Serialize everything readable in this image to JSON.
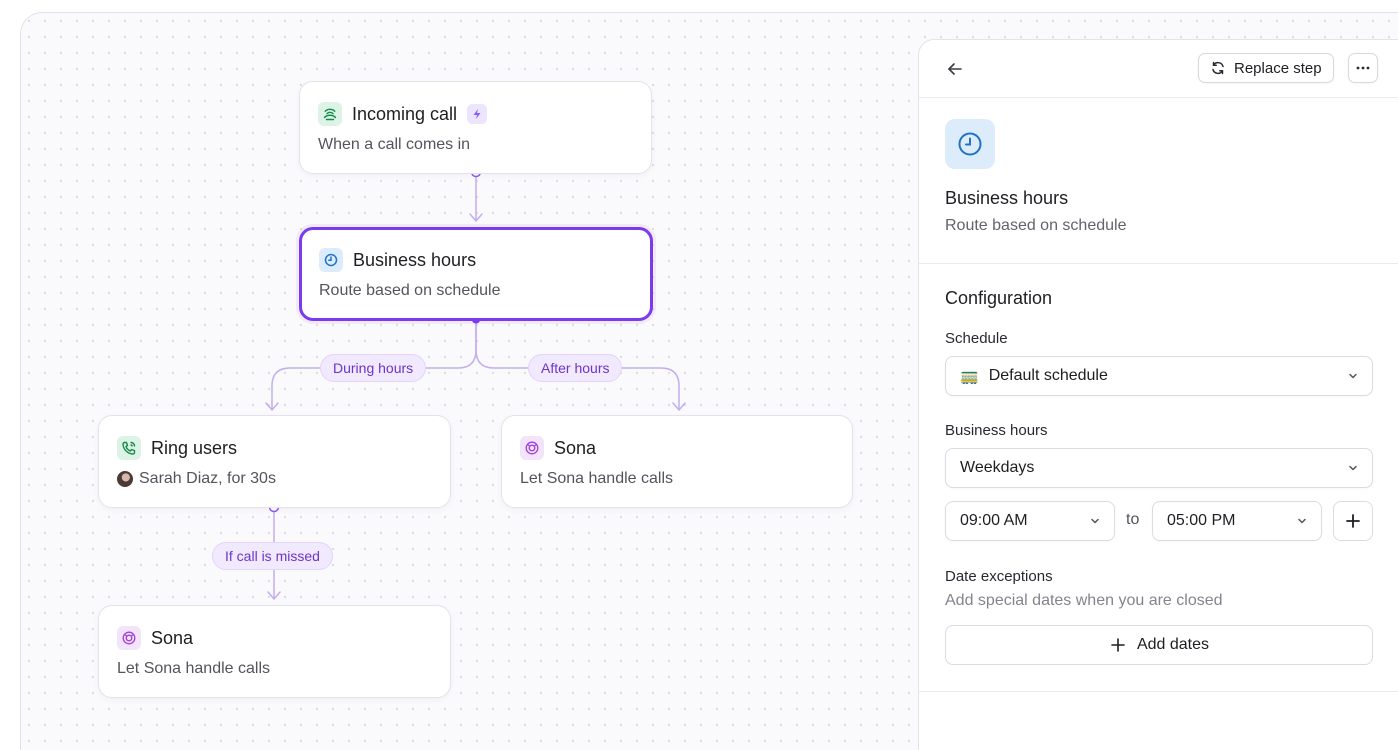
{
  "canvas": {
    "nodes": {
      "incoming_call": {
        "title": "Incoming call",
        "subtitle": "When a call comes in",
        "icon": "phone-signal-icon",
        "badge_icon": "bolt-icon"
      },
      "business_hours": {
        "title": "Business hours",
        "subtitle": "Route based on schedule",
        "icon": "clock-icon"
      },
      "ring_users": {
        "title": "Ring users",
        "subtitle": "Sarah Diaz, for 30s",
        "icon": "phone-ring-icon"
      },
      "sona_after": {
        "title": "Sona",
        "subtitle": "Let Sona handle calls",
        "icon": "sona-icon"
      },
      "sona_missed": {
        "title": "Sona",
        "subtitle": "Let Sona handle calls",
        "icon": "sona-icon"
      }
    },
    "branches": {
      "during_hours": "During hours",
      "after_hours": "After hours",
      "if_missed": "If call is missed"
    }
  },
  "panel": {
    "replace_label": "Replace step",
    "step_title": "Business hours",
    "step_subtitle": "Route based on schedule",
    "config_title": "Configuration",
    "schedule_label": "Schedule",
    "schedule_emoji": "🚃",
    "schedule_value": "Default schedule",
    "business_hours_label": "Business hours",
    "days_value": "Weekdays",
    "start_time": "09:00 AM",
    "to_label": "to",
    "end_time": "05:00 PM",
    "exceptions_label": "Date exceptions",
    "exceptions_hint": "Add special dates when you are closed",
    "add_dates_label": "Add dates"
  },
  "colors": {
    "accent": "#7c3aed",
    "chip_bg": "#f1e9fd",
    "connector": "#c2aef0"
  }
}
